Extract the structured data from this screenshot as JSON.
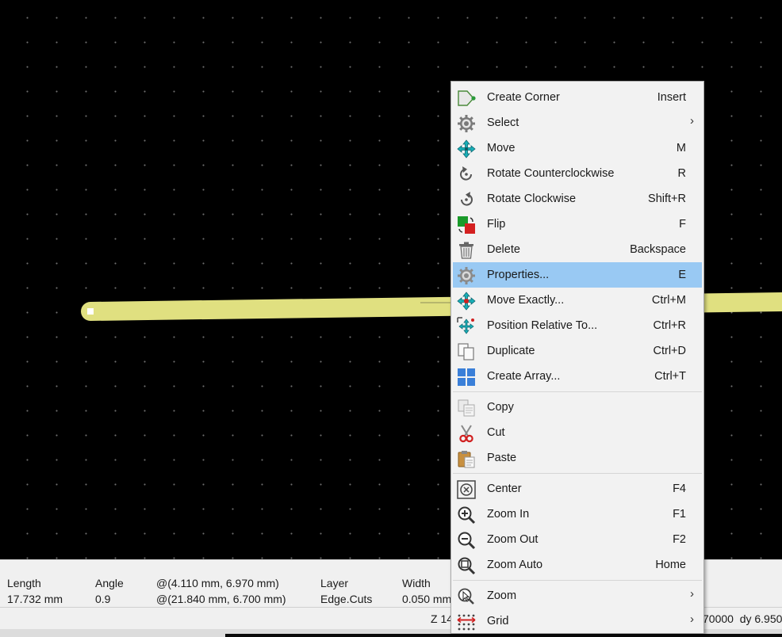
{
  "menu": {
    "items": [
      {
        "label": "Create Corner",
        "shortcut": "Insert",
        "icon": "create-corner-icon"
      },
      {
        "label": "Select",
        "shortcut": "",
        "submenu": true,
        "icon": "gear-icon"
      },
      {
        "label": "Move",
        "shortcut": "M",
        "icon": "move-icon"
      },
      {
        "label": "Rotate Counterclockwise",
        "shortcut": "R",
        "icon": "rotate-ccw-icon"
      },
      {
        "label": "Rotate Clockwise",
        "shortcut": "Shift+R",
        "icon": "rotate-cw-icon"
      },
      {
        "label": "Flip",
        "shortcut": "F",
        "icon": "flip-icon"
      },
      {
        "label": "Delete",
        "shortcut": "Backspace",
        "icon": "trash-icon"
      },
      {
        "label": "Properties...",
        "shortcut": "E",
        "icon": "properties-gear-icon",
        "highlighted": true
      },
      {
        "label": "Move Exactly...",
        "shortcut": "Ctrl+M",
        "icon": "move-exactly-icon"
      },
      {
        "label": "Position Relative To...",
        "shortcut": "Ctrl+R",
        "icon": "position-relative-icon"
      },
      {
        "label": "Duplicate",
        "shortcut": "Ctrl+D",
        "icon": "duplicate-icon"
      },
      {
        "label": "Create Array...",
        "shortcut": "Ctrl+T",
        "icon": "array-icon"
      },
      {
        "label": "Copy",
        "shortcut": "",
        "icon": "copy-icon"
      },
      {
        "label": "Cut",
        "shortcut": "",
        "icon": "scissors-icon"
      },
      {
        "label": "Paste",
        "shortcut": "",
        "icon": "paste-icon"
      },
      {
        "label": "Center",
        "shortcut": "F4",
        "icon": "zoom-center-icon"
      },
      {
        "label": "Zoom In",
        "shortcut": "F1",
        "icon": "zoom-in-icon"
      },
      {
        "label": "Zoom Out",
        "shortcut": "F2",
        "icon": "zoom-out-icon"
      },
      {
        "label": "Zoom Auto",
        "shortcut": "Home",
        "icon": "zoom-auto-icon"
      },
      {
        "label": "Zoom",
        "shortcut": "",
        "submenu": true,
        "icon": "zoom-cursor-icon"
      },
      {
        "label": "Grid",
        "shortcut": "",
        "submenu": true,
        "icon": "grid-icon"
      }
    ],
    "submenu_glyph": "›"
  },
  "message_panel": {
    "length_label": "Length",
    "length_value": "17.732 mm",
    "angle_label": "Angle",
    "angle_value": "0.9",
    "start_point": "@(4.110 mm, 6.970 mm)",
    "end_point": "@(21.840 mm, 6.700 mm)",
    "layer_label": "Layer",
    "layer_value": "Edge.Cuts",
    "width_label": "Width",
    "width_value": "0.050 mm"
  },
  "status_bar": {
    "zoom_text": "Z 14",
    "delta_text": "70000  dy 6.950"
  },
  "colors": {
    "canvas_bg": "#000000",
    "track": "#e0e080",
    "menu_highlight": "#99c9f3"
  }
}
